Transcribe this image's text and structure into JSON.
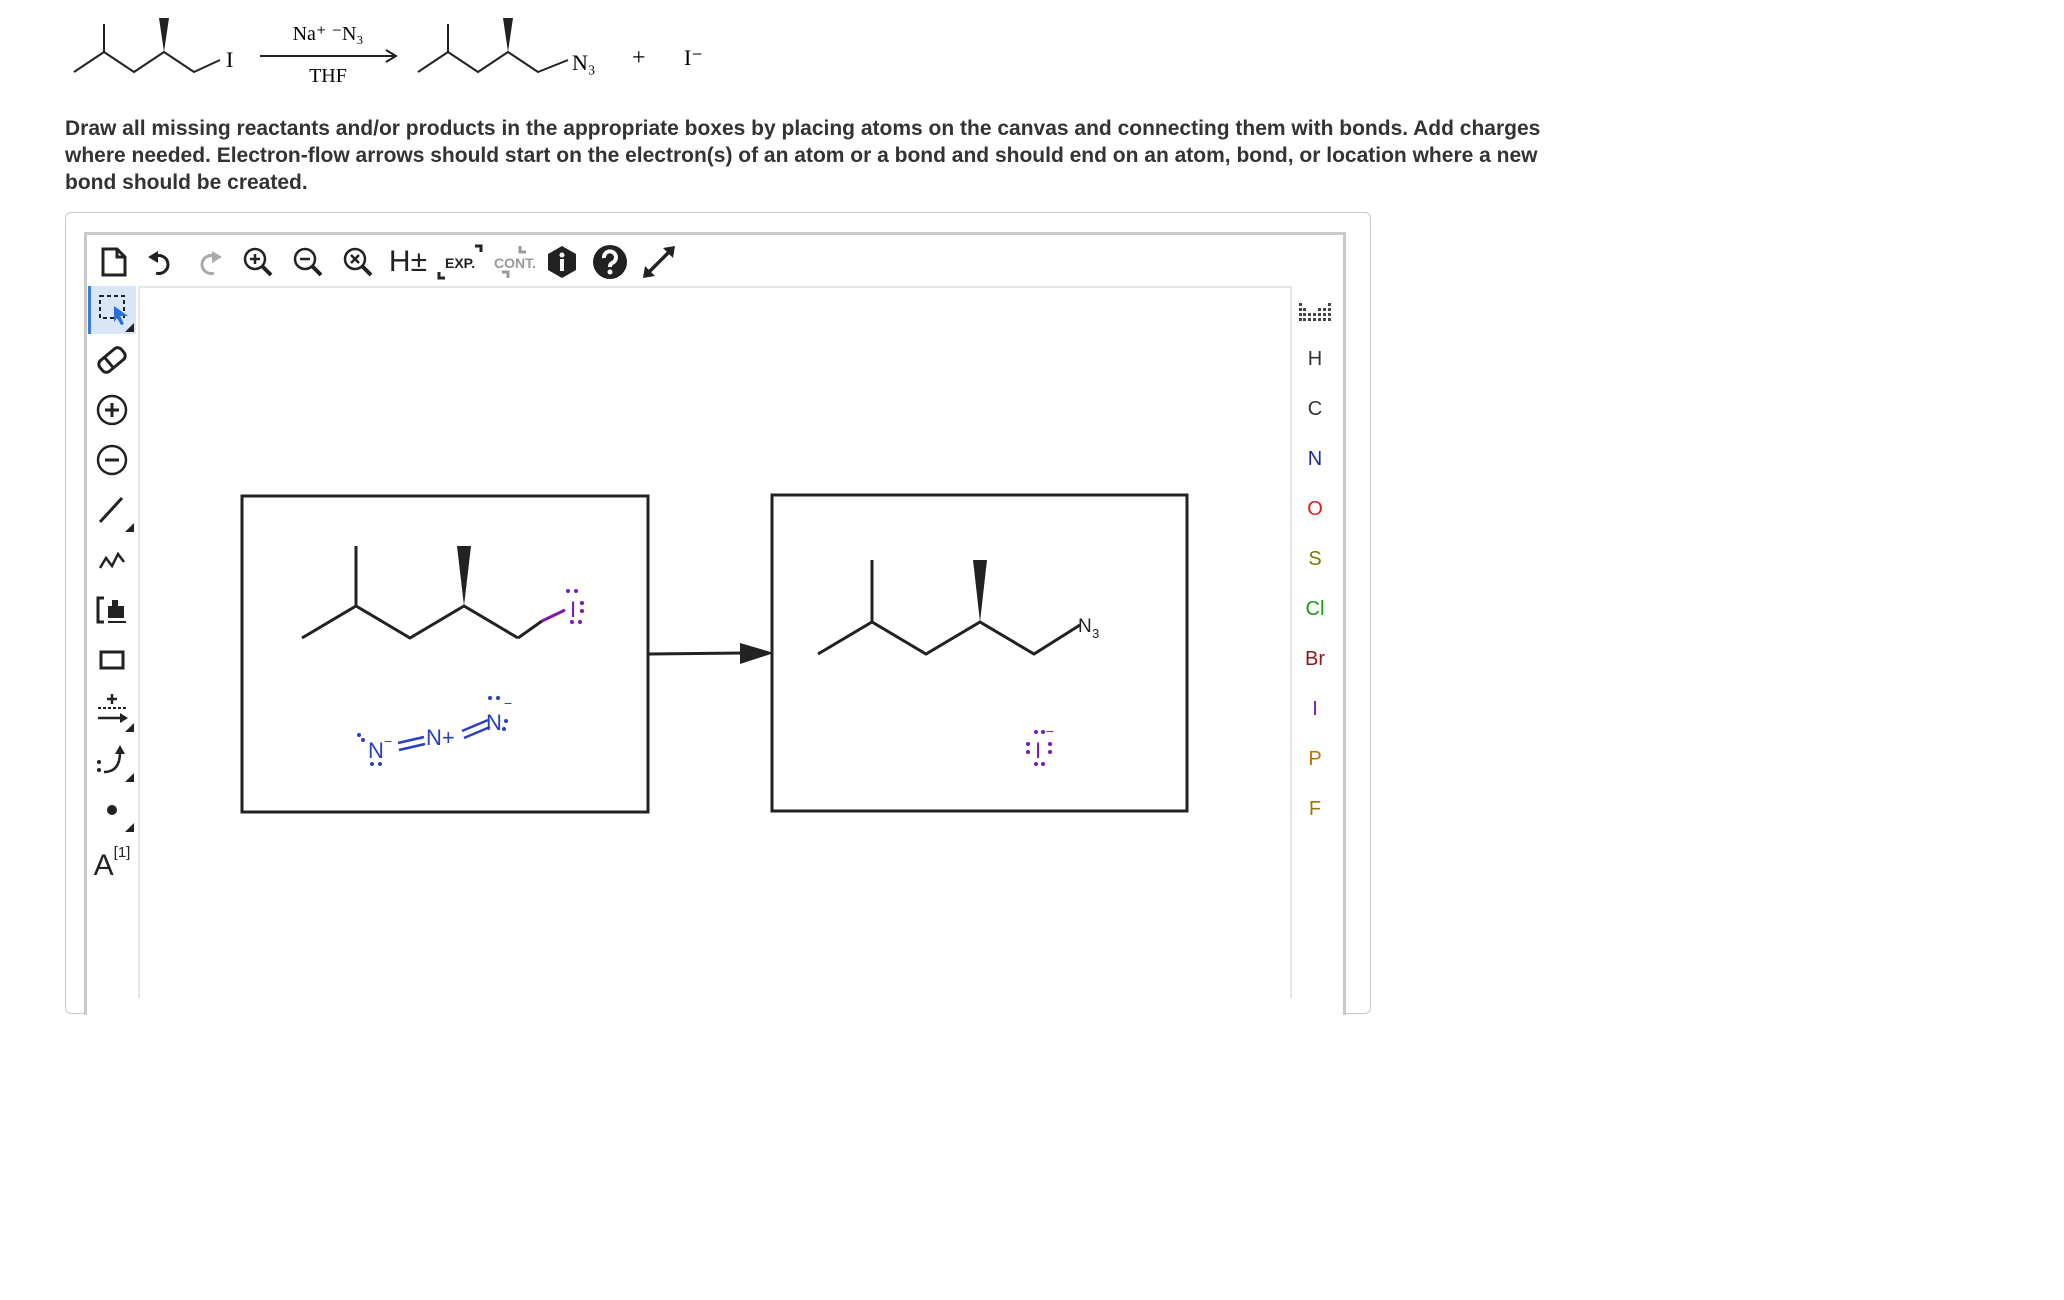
{
  "reaction": {
    "reactant_leaving_group": "I",
    "reagent_top": "Na⁺ ⁻N₃",
    "reagent_bottom": "THF",
    "product_group": "N₃",
    "plus": "+",
    "byproduct": "I⁻"
  },
  "instructions": [
    "Draw all missing reactants and/or products in the appropriate boxes by placing atoms on the canvas and connecting them with bonds. Add charges",
    "where needed. Electron-flow arrows should start on the electron(s) of an atom or a bond and should end on an atom, bond, or location where a new",
    "bond should be created."
  ],
  "toolbar": {
    "exp_label": "EXP.",
    "cont_label": "CONT.",
    "h_label": "H±"
  },
  "left_tools": {
    "text_label": "A",
    "text_index": "[1]"
  },
  "elements": [
    "H",
    "C",
    "N",
    "O",
    "S",
    "Cl",
    "Br",
    "I",
    "P",
    "F"
  ],
  "element_colors": {
    "H": "#333333",
    "C": "#333333",
    "N": "#1f2a9a",
    "O": "#e01b1b",
    "S": "#7a7a00",
    "Cl": "#1a9a1a",
    "Br": "#8a1a1a",
    "I": "#7a1ab0",
    "P": "#c07000",
    "F": "#9a7a00"
  },
  "canvas": {
    "reactant_iodo": "I",
    "azide_left_N": "N",
    "azide_left_charge": "−",
    "azide_center": "N+",
    "azide_right_N": "N",
    "azide_right_charge": "−",
    "product_N3": "N",
    "product_N3_sub": "3",
    "iodide": "I",
    "iodide_charge": "−",
    "azide_color": "#2a3fbf",
    "iodine_color": "#7a1ab0"
  }
}
